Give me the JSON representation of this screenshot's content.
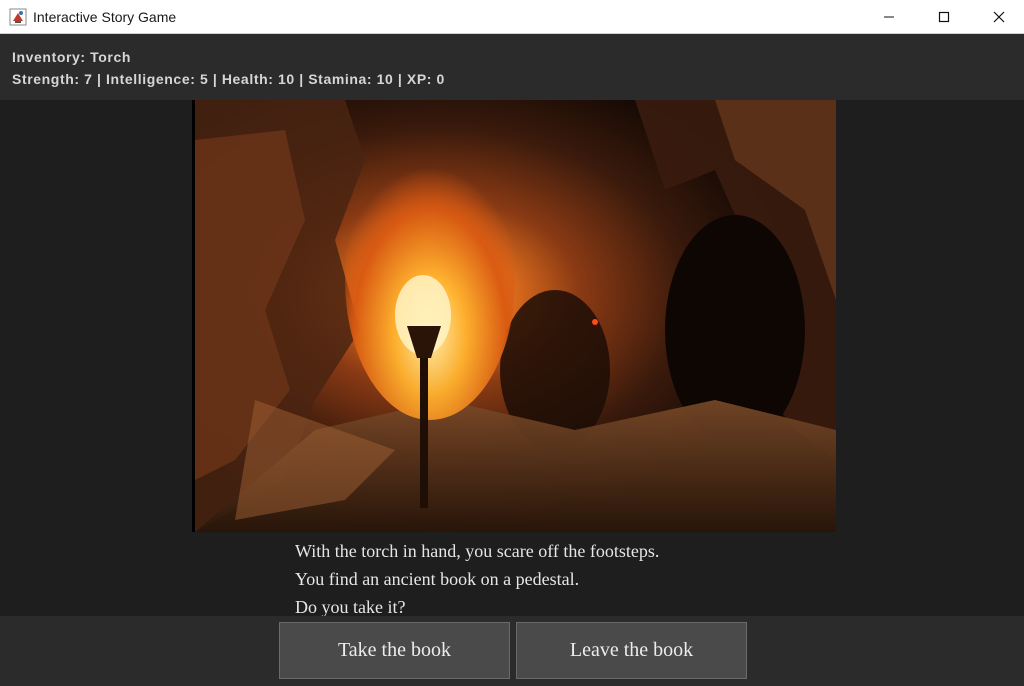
{
  "window": {
    "title": "Interactive Story Game",
    "icon": "java-app-icon",
    "controls": [
      "minimize-icon",
      "maximize-icon",
      "close-icon"
    ]
  },
  "status": {
    "inventory": "Inventory: Torch",
    "stats": "Strength: 7 | Intelligence: 5 | Health: 10 | Stamina: 10 | XP: 0"
  },
  "scene": {
    "image": "cave-with-torch-painting",
    "colors": {
      "dark": "#1a0e07",
      "flame": "#ffb22e",
      "rock": "#5a2e18"
    }
  },
  "story": {
    "lines": [
      "With the torch in hand, you scare off the footsteps.",
      "You find an ancient book on a pedestal.",
      "Do you take it?"
    ]
  },
  "choices": {
    "take": "Take the book",
    "leave": "Leave the book"
  },
  "theme": {
    "background": "#1e1e1e",
    "panel": "#2b2b2b",
    "button": "#4a4a4a",
    "text": "#e6e6e6"
  }
}
